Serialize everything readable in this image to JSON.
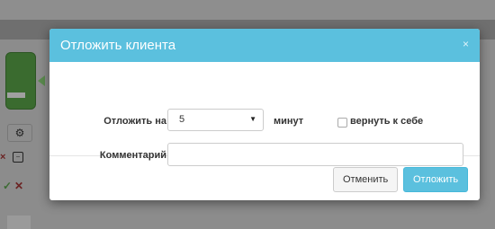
{
  "modal": {
    "title": "Отложить клиента",
    "close_glyph": "×",
    "postpone_label": "Отложить на",
    "minutes_select": {
      "value": "5",
      "caret_glyph": "▼"
    },
    "minutes_label": "минут",
    "return_checkbox": {
      "label": "вернуть к себе",
      "checked": false
    },
    "comment_label": "Комментарий",
    "comment_input": {
      "value": "",
      "placeholder": ""
    },
    "buttons": {
      "cancel": "Отменить",
      "submit": "Отложить"
    },
    "colors": {
      "header": "#5bc0de",
      "submit": "#5bc0de"
    }
  },
  "background": {
    "icons": [
      "gear-icon",
      "close-icon",
      "check-icon",
      "collapse-icon"
    ]
  }
}
